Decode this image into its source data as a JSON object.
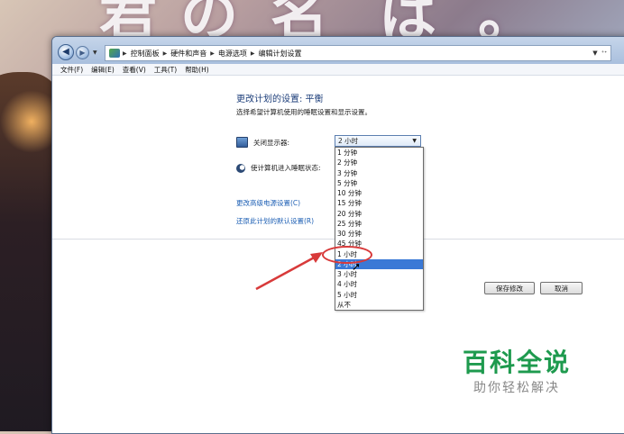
{
  "wallpaper": {
    "chars": [
      "君",
      "の",
      "名",
      "は",
      "。"
    ]
  },
  "address_bar": {
    "breadcrumbs": [
      "控制面板",
      "硬件和声音",
      "电源选项",
      "编辑计划设置"
    ],
    "refresh_symbol": "⁺ᐩ"
  },
  "menu": [
    "文件(F)",
    "编辑(E)",
    "查看(V)",
    "工具(T)",
    "帮助(H)"
  ],
  "page": {
    "title": "更改计划的设置: 平衡",
    "subtitle": "选择希望计算机使用的睡眠设置和显示设置。",
    "display_off_label": "关闭显示器:",
    "sleep_label": "使计算机进入睡眠状态:",
    "display_off_value": "2 小时",
    "advanced_link": "更改高级电源设置(C)",
    "restore_link": "还原此计划的默认设置(R)",
    "save_button": "保存修改",
    "cancel_button": "取消"
  },
  "dropdown_options": [
    "1 分钟",
    "2 分钟",
    "3 分钟",
    "5 分钟",
    "10 分钟",
    "15 分钟",
    "20 分钟",
    "25 分钟",
    "30 分钟",
    "45 分钟",
    "1 小时",
    "2 小时",
    "3 小时",
    "4 小时",
    "5 小时",
    "从不"
  ],
  "dropdown_selected_index": 11,
  "watermark": {
    "main": "百科全说",
    "sub": "助你轻松解决"
  },
  "colors": {
    "accent": "#3a79d6",
    "annotation": "#d83a3a",
    "watermark": "#1e9a4e"
  }
}
